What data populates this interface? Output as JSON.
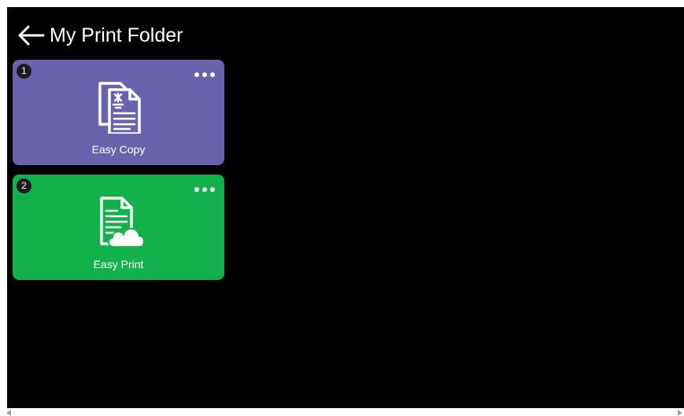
{
  "header": {
    "back_icon": "arrow-left-icon",
    "title": "My Print Folder"
  },
  "tiles": [
    {
      "number": "1",
      "label": "Easy Copy",
      "color": "#6a62ad",
      "icon": "copy-document-icon"
    },
    {
      "number": "2",
      "label": "Easy Print",
      "color": "#13b14c",
      "icon": "cloud-print-document-icon"
    }
  ],
  "colors": {
    "background": "#000000",
    "text": "#ffffff"
  }
}
